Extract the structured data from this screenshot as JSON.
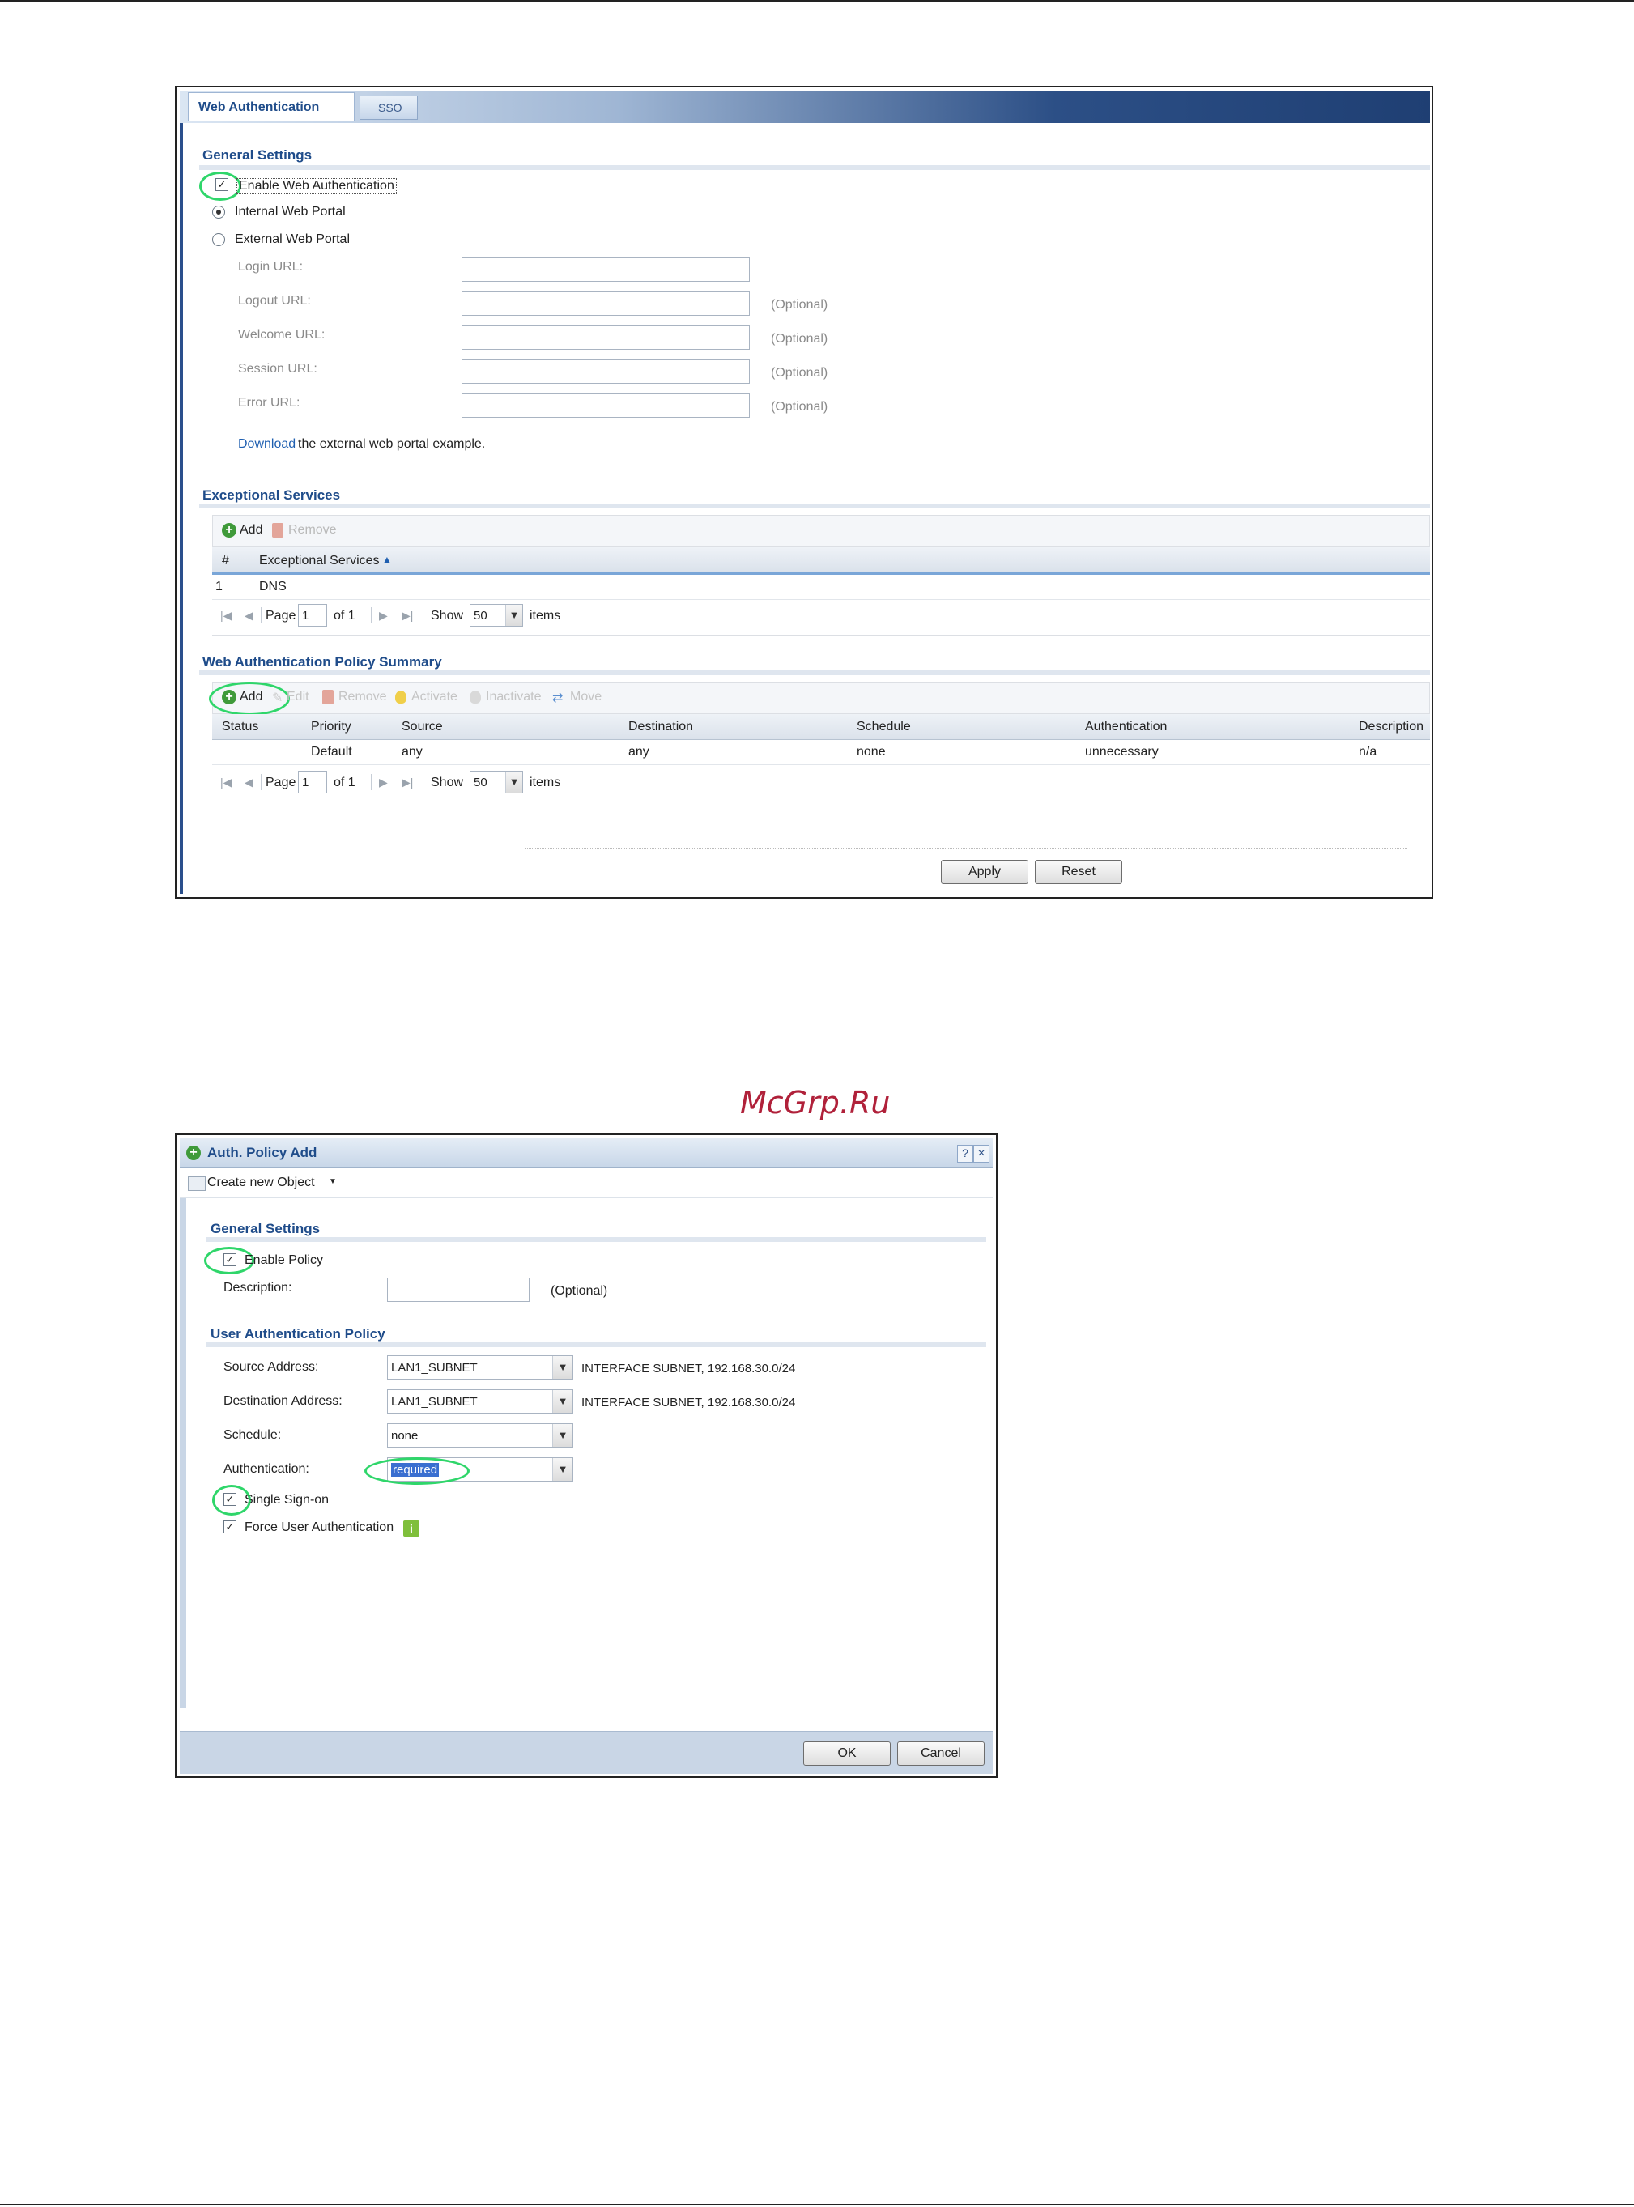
{
  "watermark": "McGrp.Ru",
  "top_panel": {
    "tabs": [
      "Web Authentication",
      "SSO"
    ],
    "general": {
      "title": "General Settings",
      "enable_label": "Enable Web Authentication",
      "internal_label": "Internal Web Portal",
      "external_label": "External Web Portal",
      "url_fields": [
        {
          "label": "Login URL:",
          "note": ""
        },
        {
          "label": "Logout URL:",
          "note": "(Optional)"
        },
        {
          "label": "Welcome URL:",
          "note": "(Optional)"
        },
        {
          "label": "Session URL:",
          "note": "(Optional)"
        },
        {
          "label": "Error URL:",
          "note": "(Optional)"
        }
      ],
      "download_link": "Download",
      "download_rest": "the external web portal example."
    },
    "exceptional": {
      "title": "Exceptional Services",
      "add": "Add",
      "remove": "Remove",
      "col_num": "#",
      "col_name": "Exceptional Services",
      "rows": [
        {
          "num": "1",
          "name": "DNS"
        }
      ],
      "pager": {
        "page_label": "Page",
        "page_value": "1",
        "of": "of 1",
        "show": "Show",
        "show_value": "50",
        "items": "items"
      }
    },
    "policy": {
      "title": "Web Authentication Policy Summary",
      "toolbar": {
        "add": "Add",
        "edit": "Edit",
        "remove": "Remove",
        "activate": "Activate",
        "inactivate": "Inactivate",
        "move": "Move"
      },
      "columns": [
        "Status",
        "Priority",
        "Source",
        "Destination",
        "Schedule",
        "Authentication",
        "Description"
      ],
      "rows": [
        {
          "status": "",
          "priority": "Default",
          "source": "any",
          "destination": "any",
          "schedule": "none",
          "authentication": "unnecessary",
          "description": "n/a"
        }
      ],
      "pager": {
        "page_label": "Page",
        "page_value": "1",
        "of": "of 1",
        "show": "Show",
        "show_value": "50",
        "items": "items"
      }
    },
    "apply": "Apply",
    "reset": "Reset"
  },
  "dialog": {
    "title": "Auth. Policy Add",
    "help": "?",
    "close": "×",
    "create_object": "Create new Object",
    "general_title": "General Settings",
    "enable_policy": "Enable Policy",
    "description_label": "Description:",
    "description_value": "",
    "description_note": "(Optional)",
    "uap_title": "User Authentication Policy",
    "source_label": "Source Address:",
    "source_value": "LAN1_SUBNET",
    "source_info": "INTERFACE SUBNET, 192.168.30.0/24",
    "dest_label": "Destination Address:",
    "dest_value": "LAN1_SUBNET",
    "dest_info": "INTERFACE SUBNET, 192.168.30.0/24",
    "schedule_label": "Schedule:",
    "schedule_value": "none",
    "auth_label": "Authentication:",
    "auth_value": "required",
    "sso_label": "Single Sign-on",
    "force_label": "Force User Authentication",
    "ok": "OK",
    "cancel": "Cancel"
  }
}
